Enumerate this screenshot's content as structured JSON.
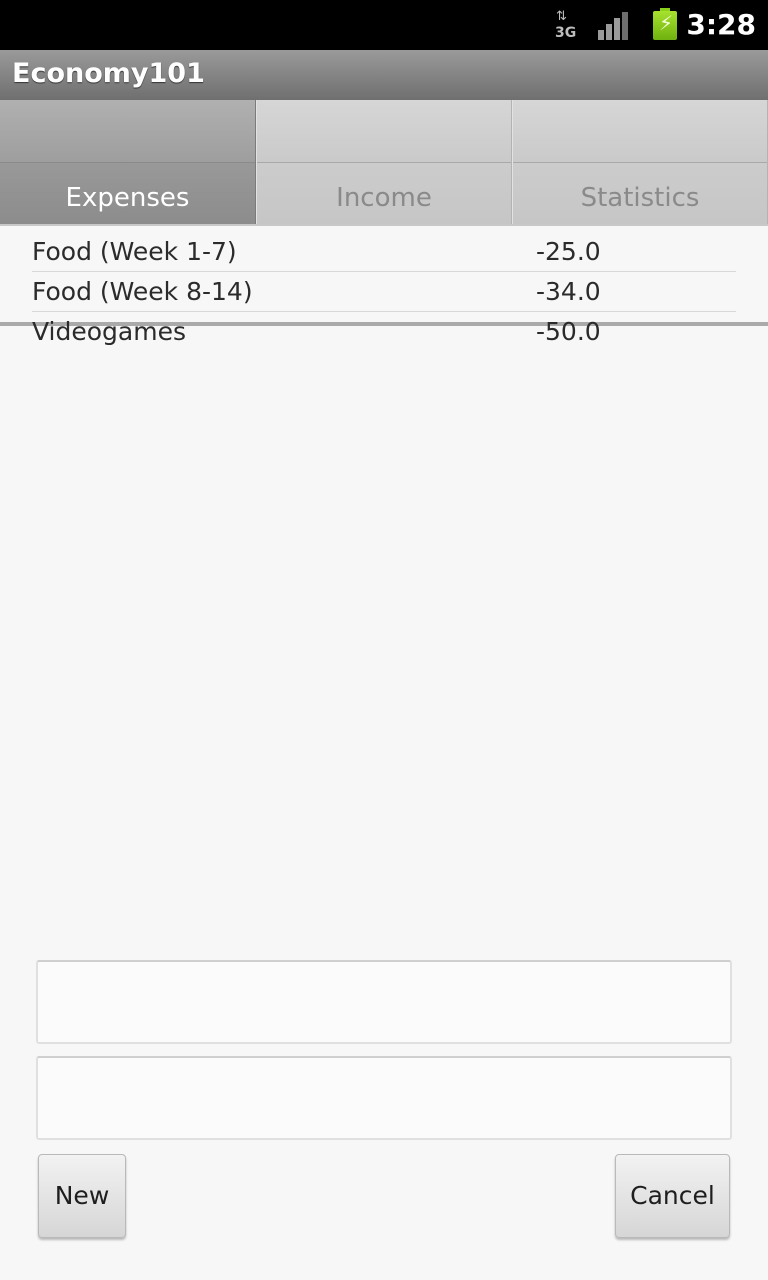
{
  "status_bar": {
    "network_label": "3G",
    "network_arrows": "⇅",
    "time": "3:28",
    "icons": [
      "data-3g-icon",
      "signal-icon",
      "battery-charging-icon"
    ],
    "battery_color": "#8ad21a"
  },
  "app": {
    "title": "Economy101"
  },
  "tabs": [
    {
      "label": "Expenses",
      "selected": true
    },
    {
      "label": "Income",
      "selected": false
    },
    {
      "label": "Statistics",
      "selected": false
    }
  ],
  "expenses": [
    {
      "name": "Food (Week 1-7)",
      "amount": "-25.0"
    },
    {
      "name": "Food (Week 8-14)",
      "amount": "-34.0"
    },
    {
      "name": "Videogames",
      "amount": "-50.0"
    }
  ],
  "form": {
    "field1_value": "",
    "field2_value": "",
    "new_label": "New",
    "cancel_label": "Cancel"
  }
}
